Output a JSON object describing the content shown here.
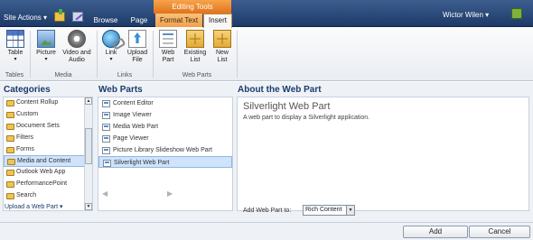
{
  "topbar": {
    "site_actions": "Site Actions ▾",
    "tabs": {
      "browse": "Browse",
      "page": "Page"
    },
    "context_group": "Editing Tools",
    "context_tabs": {
      "format_text": "Format Text",
      "insert": "Insert"
    },
    "user_name": "Wictor Wilen ▾"
  },
  "ribbon": {
    "buttons": {
      "table": "Table",
      "picture": "Picture",
      "video_audio": "Video and Audio",
      "link": "Link",
      "upload_file": "Upload File",
      "web_part": "Web Part",
      "existing_list": "Existing List",
      "new_list": "New List"
    },
    "groups": {
      "tables": "Tables",
      "media": "Media",
      "links": "Links",
      "web_parts": "Web Parts"
    }
  },
  "categories": {
    "heading": "Categories",
    "items": [
      "Content Rollup",
      "Custom",
      "Document Sets",
      "Filters",
      "Forms",
      "Media and Content",
      "Outlook Web App",
      "PerformancePoint",
      "Search"
    ],
    "selected_index": 5,
    "upload_link": "Upload a Web Part ▾"
  },
  "web_parts": {
    "heading": "Web Parts",
    "items": [
      "Content Editor",
      "Image Viewer",
      "Media Web Part",
      "Page Viewer",
      "Picture Library Slideshow Web Part",
      "Silverlight Web Part"
    ],
    "selected_index": 5
  },
  "about": {
    "heading": "About the Web Part",
    "title": "Silverlight Web Part",
    "description": "A web part to display a Silverlight application.",
    "add_to_label": "Add Web Part to:",
    "add_to_value": "Rich Content"
  },
  "footer": {
    "add_label": "Add",
    "cancel_label": "Cancel"
  }
}
